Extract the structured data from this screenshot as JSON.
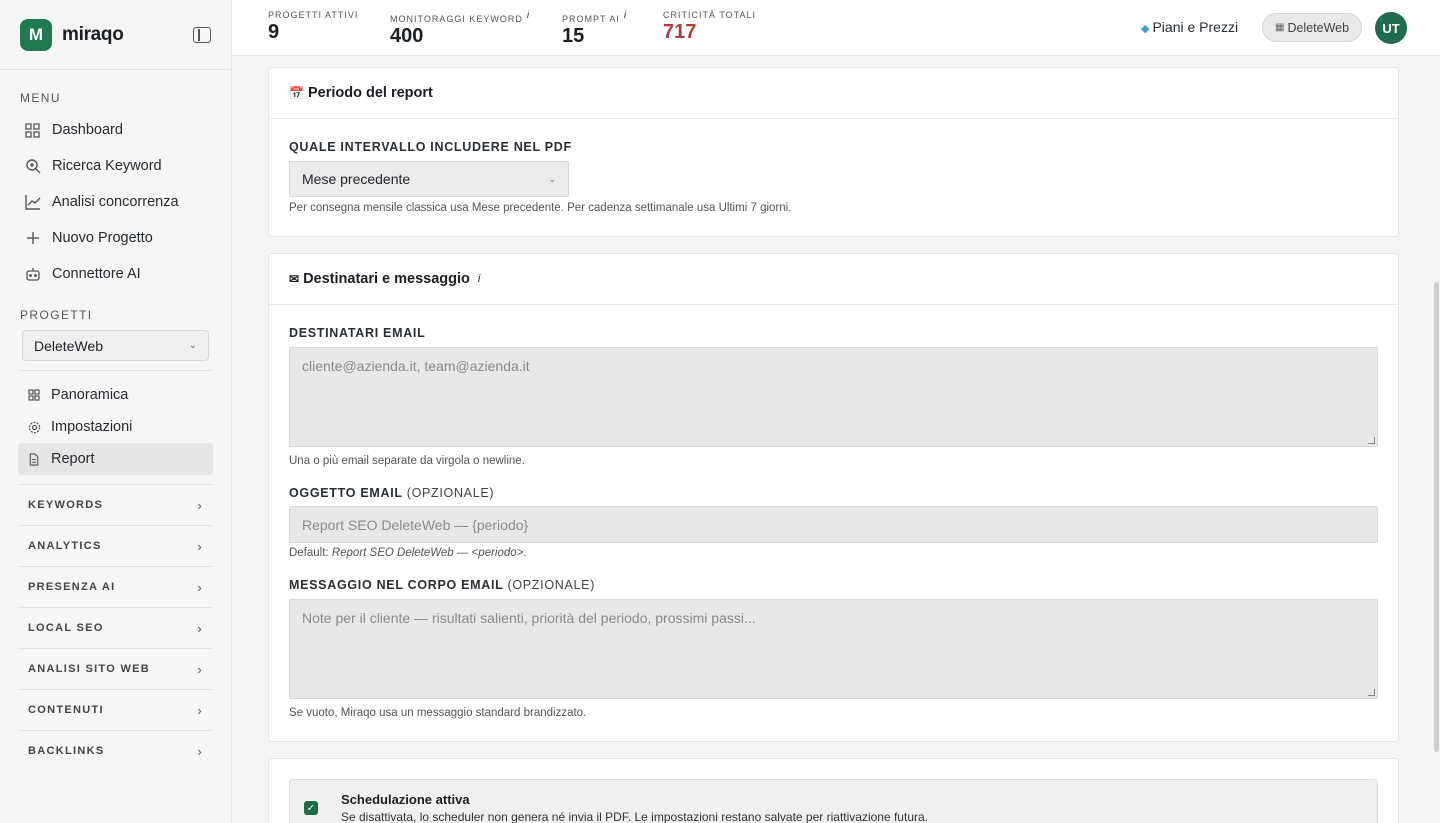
{
  "brand": {
    "logo_letter": "M",
    "name": "miraqo"
  },
  "sidebar": {
    "menu_label": "MENU",
    "menu": [
      {
        "label": "Dashboard",
        "icon": "grid-icon"
      },
      {
        "label": "Ricerca Keyword",
        "icon": "search-icon"
      },
      {
        "label": "Analisi concorrenza",
        "icon": "line-chart-icon"
      },
      {
        "label": "Nuovo Progetto",
        "icon": "plus-icon"
      },
      {
        "label": "Connettore AI",
        "icon": "robot-icon"
      }
    ],
    "projects_label": "PROGETTI",
    "project_selected": "DeleteWeb",
    "project_items": [
      {
        "label": "Panoramica",
        "icon": "grid-icon",
        "active": false
      },
      {
        "label": "Impostazioni",
        "icon": "gear-icon",
        "active": false
      },
      {
        "label": "Report",
        "icon": "document-icon",
        "active": true
      }
    ],
    "groups": [
      "KEYWORDS",
      "ANALYTICS",
      "PRESENZA AI",
      "LOCAL SEO",
      "ANALISI SITO WEB",
      "CONTENUTI",
      "BACKLINKS"
    ]
  },
  "topbar": {
    "stats": [
      {
        "label": "PROGETTI ATTIVI",
        "value": "9",
        "info": ""
      },
      {
        "label": "MONITORAGGI KEYWORD",
        "value": "400",
        "info": "i"
      },
      {
        "label": "PROMPT AI",
        "value": "15",
        "info": "i"
      },
      {
        "label": "CRITICITÀ TOTALI",
        "value": "717",
        "info": ""
      }
    ],
    "plans_label": "Piani e Prezzi",
    "workspace_label": "DeleteWeb",
    "avatar_initials": "UT",
    "critical_color": "#b33a3a",
    "accent_color": "#1f7a52"
  },
  "period_card": {
    "title": "Periodo del report",
    "icon": "calendar-icon",
    "field_label": "QUALE INTERVALLO INCLUDERE NEL PDF",
    "selected": "Mese precedente",
    "help": "Per consegna mensile classica usa Mese precedente. Per cadenza settimanale usa Ultimi 7 giorni."
  },
  "recipients_card": {
    "title": "Destinatari e messaggio",
    "icon": "envelope-icon",
    "info": "i",
    "emails_label": "DESTINATARI EMAIL",
    "emails_placeholder": "cliente@azienda.it, team@azienda.it",
    "emails_help": "Una o più email separate da virgola o newline.",
    "subject_label": "OGGETTO EMAIL",
    "subject_optional": "(OPZIONALE)",
    "subject_placeholder": "Report SEO DeleteWeb — {periodo}",
    "subject_help_prefix": "Default: ",
    "subject_help_default": "Report SEO DeleteWeb — <periodo>",
    "subject_help_suffix": ".",
    "body_label": "MESSAGGIO NEL CORPO EMAIL",
    "body_optional": "(OPZIONALE)",
    "body_placeholder": "Note per il cliente — risultati salienti, priorità del periodo, prossimi passi...",
    "body_help": "Se vuoto, Miraqo usa un messaggio standard brandizzato."
  },
  "schedule": {
    "checked": true,
    "title": "Schedulazione attiva",
    "description": "Se disattivata, lo scheduler non genera né invia il PDF. Le impostazioni restano salvate per riattivazione futura."
  }
}
